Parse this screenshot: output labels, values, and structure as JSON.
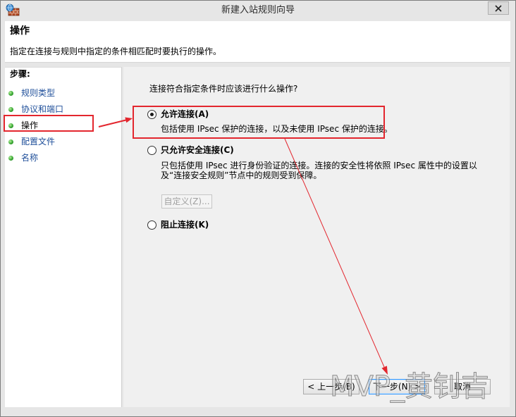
{
  "window": {
    "title": "新建入站规则向导",
    "app_icon": "firewall-icon",
    "close_icon": "close-icon"
  },
  "header": {
    "title": "操作",
    "description": "指定在连接与规则中指定的条件相匹配时要执行的操作。"
  },
  "steps": {
    "heading": "步骤:",
    "items": [
      {
        "label": "规则类型",
        "current": false
      },
      {
        "label": "协议和端口",
        "current": false
      },
      {
        "label": "操作",
        "current": true
      },
      {
        "label": "配置文件",
        "current": false
      },
      {
        "label": "名称",
        "current": false
      }
    ]
  },
  "main": {
    "question": "连接符合指定条件时应该进行什么操作?",
    "options": [
      {
        "label": "允许连接(A)",
        "selected": true,
        "description_lines": [
          "包括使用 IPsec 保护的连接，以及未使用 IPsec 保护的连接。"
        ]
      },
      {
        "label": "只允许安全连接(C)",
        "selected": false,
        "description_lines": [
          "只包括使用 IPsec 进行身份验证的连接。连接的安全性将依照 IPsec 属性中的设置以",
          "及“连接安全规则”节点中的规则受到保障。"
        ]
      },
      {
        "label": "阻止连接(K)",
        "selected": false,
        "description_lines": []
      }
    ],
    "customize": {
      "label": "自定义(Z)...",
      "enabled": false
    }
  },
  "footer": {
    "back_label": "< 上一步(B)",
    "next_label": "下一步(N) >",
    "cancel_label": "取消"
  },
  "watermark": "MVP_黄钊吉",
  "colors": {
    "annotation": "#e3262e",
    "step_link": "#1f4f9a",
    "bullet": "#3aa935",
    "default_button_border": "#3399ff"
  }
}
